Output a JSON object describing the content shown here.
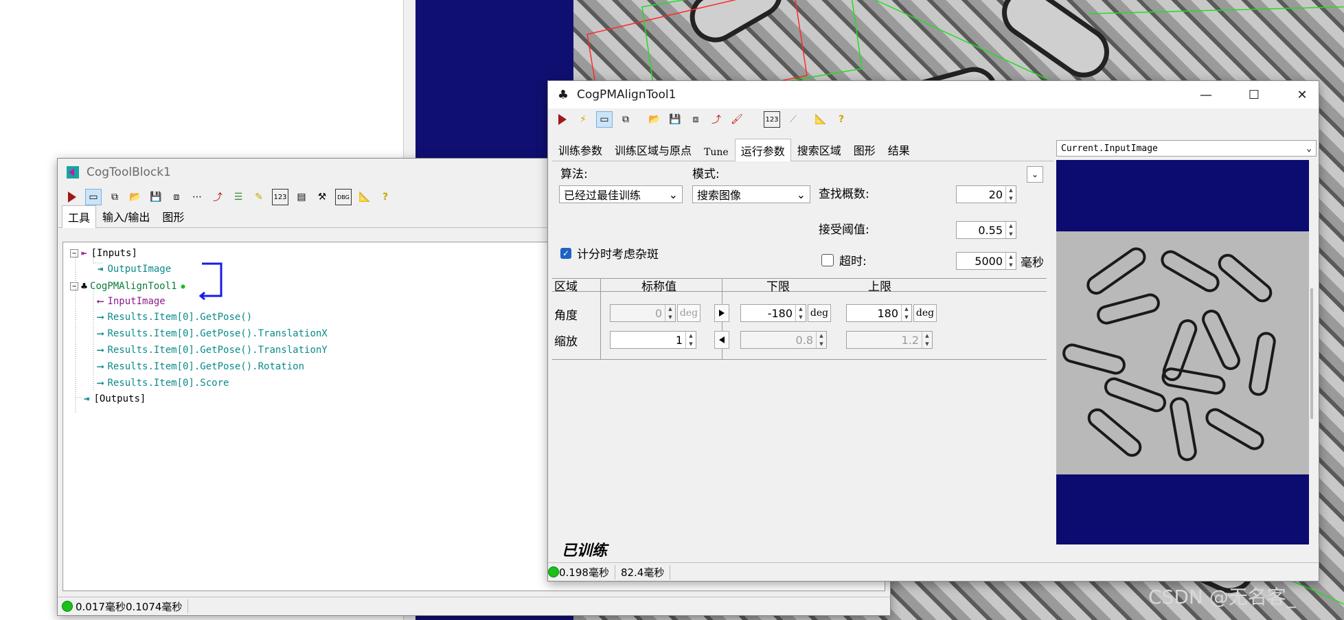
{
  "toolblock": {
    "title": "CogToolBlock1",
    "tabs": [
      "工具",
      "输入/输出",
      "图形"
    ],
    "tree": {
      "inputs": "[Inputs]",
      "output_image": "OutputImage",
      "tool": "CogPMAlignTool1",
      "input_image": "InputImage",
      "results": [
        "Results.Item[0].GetPose()",
        "Results.Item[0].GetPose().TranslationX",
        "Results.Item[0].GetPose().TranslationY",
        "Results.Item[0].GetPose().Rotation",
        "Results.Item[0].Score"
      ],
      "outputs": "[Outputs]"
    },
    "status": "0.017毫秒0.1074毫秒"
  },
  "pmalign": {
    "title": "CogPMAlignTool1",
    "tabs": [
      "训练参数",
      "训练区域与原点",
      "Tune",
      "运行参数",
      "搜索区域",
      "图形",
      "结果"
    ],
    "algorithm_label": "算法:",
    "algorithm_value": "已经过最佳训练",
    "mode_label": "模式:",
    "mode_value": "搜索图像",
    "find_count_label": "查找概数:",
    "find_count": "20",
    "accept_label": "接受阈值:",
    "accept": "0.55",
    "clutter_label": "计分时考虑杂斑",
    "timeout_label": "超时:",
    "timeout": "5000",
    "timeout_unit": "毫秒",
    "grid_headers": [
      "区域",
      "标称值",
      "下限",
      "上限"
    ],
    "angle": {
      "label": "角度",
      "nominal": "0",
      "unit": "deg",
      "low": "-180",
      "low_unit": "deg",
      "high": "180",
      "high_unit": "deg"
    },
    "scale": {
      "label": "缩放",
      "nominal": "1",
      "low": "0.8",
      "high": "1.2"
    },
    "trained_label": "已训练",
    "status1": "0.198毫秒",
    "status2": "82.4毫秒",
    "image_selector": "Current.InputImage"
  },
  "watermark": "CSDN @无名客_"
}
